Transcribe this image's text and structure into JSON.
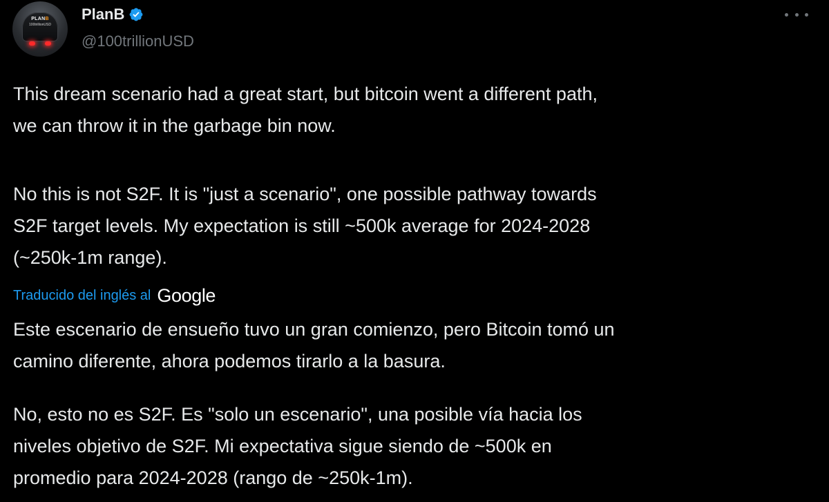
{
  "tweet": {
    "author": {
      "display_name": "PlanB",
      "handle": "@100trillionUSD",
      "verified": true,
      "avatar": {
        "line1_prefix": "PLAN",
        "line1_suffix": "B",
        "line2": "100trillionUSD"
      }
    },
    "more_icon": "more-horizontal-icon",
    "original_text": {
      "paragraph1": "This dream scenario had a great start, but bitcoin went a different path,\nwe can throw it in the garbage bin now.",
      "paragraph2": "No this is not S2F. It is \"just a scenario\", one possible pathway towards\nS2F target levels. My expectation is still ~500k average for 2024-2028\n(~250k-1m range)."
    },
    "translation": {
      "label": "Traducido del inglés al",
      "provider": "Google",
      "paragraph1": "Este escenario de ensueño tuvo un gran comienzo, pero Bitcoin tomó un\ncamino diferente, ahora podemos tirarlo a la basura.",
      "paragraph2": "No, esto no es S2F. Es \"solo un escenario\", una posible vía hacia los\nniveles objetivo de S2F. Mi expectativa sigue siendo de ~500k en\npromedio para 2024-2028 (rango de ~250k-1m)."
    }
  },
  "colors": {
    "background": "#000000",
    "text_primary": "#e7e9ea",
    "text_secondary": "#71767b",
    "link_blue": "#1d9bf0",
    "verified_blue": "#1d9bf0",
    "avatar_eye_red": "#ff2a2a",
    "bitcoin_orange": "#f7931a"
  }
}
